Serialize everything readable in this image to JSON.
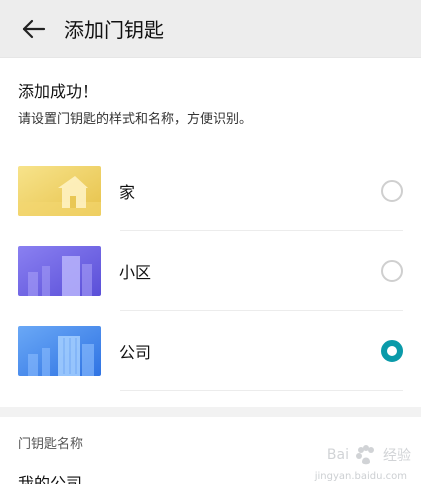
{
  "header": {
    "title": "添加门钥匙",
    "back_icon": "arrow-left-icon"
  },
  "content": {
    "success_title": "添加成功！",
    "instruction": "请设置门钥匙的样式和名称，方便识别。"
  },
  "options": [
    {
      "label": "家",
      "selected": false,
      "thumb_color": "#f2d45f",
      "icon": "house-thumbnail"
    },
    {
      "label": "小区",
      "selected": false,
      "thumb_color": "#6c63e6",
      "icon": "community-thumbnail"
    },
    {
      "label": "公司",
      "selected": true,
      "thumb_color": "#4a8ef3",
      "icon": "company-thumbnail"
    }
  ],
  "name_section": {
    "label": "门钥匙名称",
    "value": "我的公司"
  },
  "colors": {
    "accent": "#0a9aa9",
    "header_bg": "#ededed"
  },
  "watermark": {
    "left": "Bai",
    "right": "经验",
    "bottom": "jingyan.baidu.com"
  }
}
